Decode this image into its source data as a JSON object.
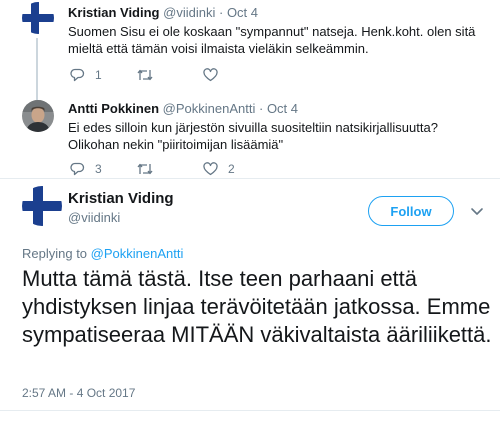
{
  "tweets": [
    {
      "name": "Kristian Viding",
      "handle": "@viidinki",
      "dot": "·",
      "date": "Oct 4",
      "text": "Suomen Sisu ei ole koskaan \"sympannut\" natseja. Henk.koht. olen sitä mieltä että tämän voisi ilmaista vieläkin selkeämmin.",
      "reply_count": "1",
      "retweet_count": "",
      "like_count": ""
    },
    {
      "name": "Antti Pokkinen",
      "handle": "@PokkinenAntti",
      "dot": "·",
      "date": "Oct 4",
      "text": "Ei edes silloin kun järjestön sivuilla suositeltiin natsikirjallisuutta? Olikohan nekin \"piiritoimijan lisäämiä\"",
      "reply_count": "3",
      "retweet_count": "",
      "like_count": "2"
    }
  ],
  "main": {
    "name": "Kristian Viding",
    "handle": "@viidinki",
    "follow_label": "Follow",
    "replying_prefix": "Replying to",
    "replying_to": "@PokkinenAntti",
    "text": "Mutta tämä tästä. Itse teen parhaani että yhdistyksen linjaa terävöitetään jatkossa. Emme sympatiseeraa MITÄÄN väkivaltaista ääriliikettä.",
    "timestamp": "2:57 AM - 4 Oct 2017"
  },
  "icons": {
    "reply": "reply-icon",
    "retweet": "retweet-icon",
    "like": "heart-icon",
    "more": "chevron-down-icon"
  },
  "colors": {
    "accent": "#1da1f2",
    "muted": "#657786",
    "text": "#14171a",
    "separator": "#e6ecf0"
  }
}
